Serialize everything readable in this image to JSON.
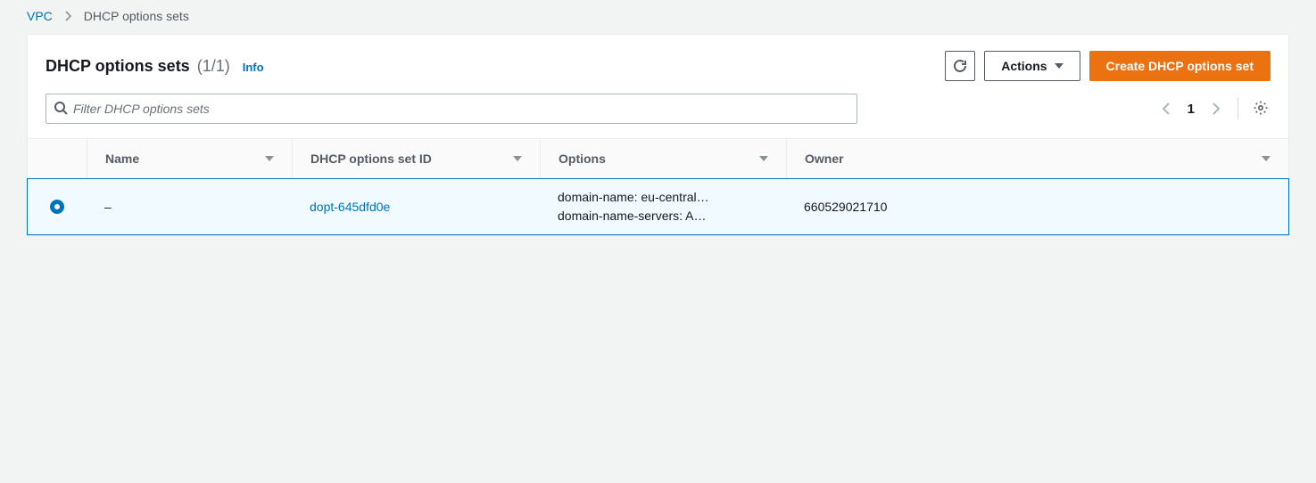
{
  "breadcrumb": {
    "root": "VPC",
    "current": "DHCP options sets"
  },
  "header": {
    "title": "DHCP options sets",
    "count": "(1/1)",
    "info": "Info",
    "actions_label": "Actions",
    "create_label": "Create DHCP options set"
  },
  "search": {
    "placeholder": "Filter DHCP options sets"
  },
  "pagination": {
    "page": "1"
  },
  "columns": {
    "name": "Name",
    "id": "DHCP options set ID",
    "options": "Options",
    "owner": "Owner"
  },
  "rows": [
    {
      "name": "–",
      "id": "dopt-645dfd0e",
      "options_line1": "domain-name: eu-central…",
      "options_line2": "domain-name-servers: A…",
      "owner": "660529021710",
      "selected": true
    }
  ]
}
